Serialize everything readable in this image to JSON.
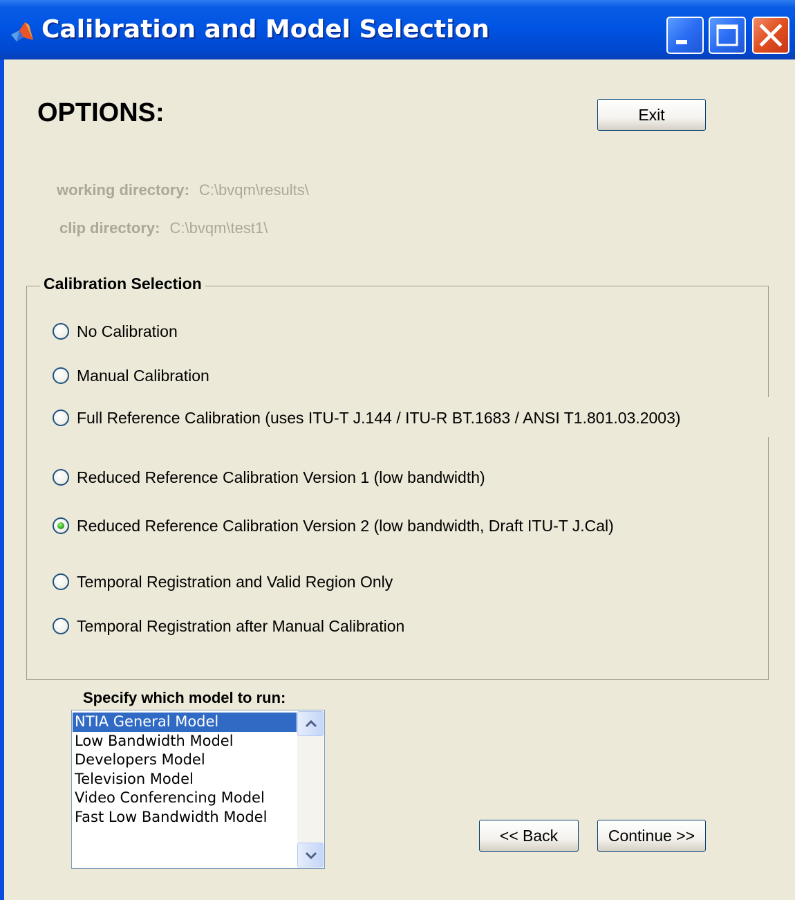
{
  "window": {
    "title": "Calibration and Model Selection"
  },
  "header": {
    "options_label": "OPTIONS:",
    "exit_label": "Exit"
  },
  "directories": {
    "working_label": "working directory:",
    "working_value": "C:\\bvqm\\results\\",
    "clip_label": "clip directory:",
    "clip_value": "C:\\bvqm\\test1\\"
  },
  "calibration": {
    "title": "Calibration Selection",
    "selected_index": 4,
    "options": [
      "No Calibration",
      "Manual Calibration",
      "Full Reference Calibration (uses ITU-T J.144 / ITU-R BT.1683 / ANSI T1.801.03.2003)",
      "Reduced Reference Calibration Version 1 (low bandwidth)",
      "Reduced Reference Calibration Version 2 (low bandwidth, Draft ITU-T J.Cal)",
      "Temporal Registration and Valid Region Only",
      "Temporal Registration after Manual Calibration"
    ]
  },
  "model": {
    "label": "Specify which model to run:",
    "selected_index": 0,
    "items": [
      "NTIA General Model",
      "Low Bandwidth Model",
      "Developers Model",
      "Television Model",
      "Video Conferencing Model",
      "Fast Low Bandwidth Model"
    ]
  },
  "nav": {
    "back_label": "<< Back",
    "continue_label": "Continue >>"
  },
  "icons": {
    "app": "matlab-icon",
    "minimize": "minimize-icon",
    "maximize": "maximize-icon",
    "close": "close-icon",
    "scroll_up": "chevron-up-icon",
    "scroll_down": "chevron-down-icon"
  },
  "colors": {
    "titlebar": "#0054e3",
    "window_bg": "#ece9d8",
    "selection": "#316ac5",
    "radio_selected": "#3bb02a",
    "disabled_text": "#aca899"
  }
}
